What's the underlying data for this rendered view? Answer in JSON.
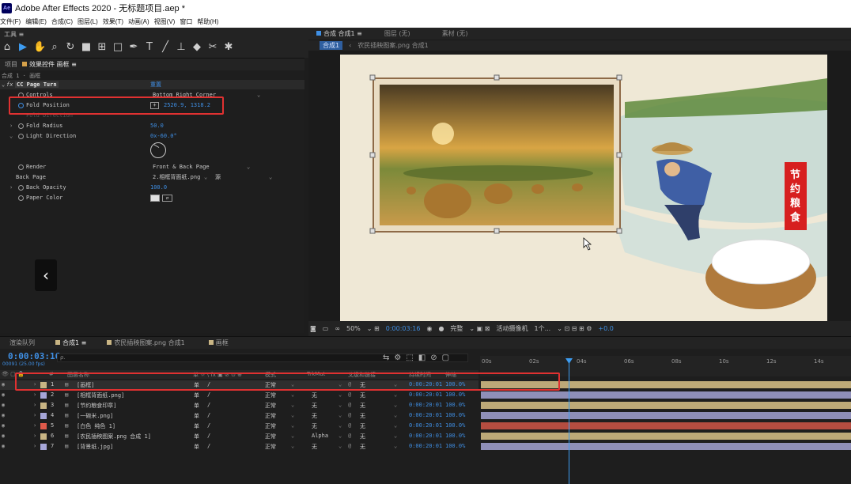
{
  "titlebar": {
    "logo": "Ae",
    "title": "Adobe After Effects 2020 - 无标题项目.aep *"
  },
  "menu": [
    "文件(F)",
    "编辑(E)",
    "合成(C)",
    "图层(L)",
    "效果(T)",
    "动画(A)",
    "视图(V)",
    "窗口",
    "帮助(H)"
  ],
  "toolbar": {
    "label": "工具 ≡",
    "icons": [
      "home-icon",
      "selection-icon",
      "hand-icon",
      "zoom-icon",
      "rotate-icon",
      "camera-icon",
      "pan-behind-icon",
      "rectangle-icon",
      "pen-icon",
      "text-icon",
      "brush-icon",
      "clone-stamp-icon",
      "eraser-icon",
      "roto-brush-icon",
      "puppet-icon"
    ]
  },
  "effects_panel": {
    "tabs": [
      "项目",
      "效果控件 画框 ≡"
    ],
    "breadcrumb": "合成 1 · 画框",
    "effect_name": "CC Page Turn",
    "reset_label": "重置",
    "rows": [
      {
        "name": "Controls",
        "value": "Bottom Right Corner"
      },
      {
        "name": "Fold Position",
        "value": "2520.9, 1318.2"
      },
      {
        "name": "Fold Direction",
        "value": ""
      },
      {
        "name": "Fold Radius",
        "value": "50.0"
      },
      {
        "name": "Light Direction",
        "value": "0x-60.0°"
      },
      {
        "name": "Render",
        "value": "Front & Back Page"
      },
      {
        "name": "Back Page",
        "value": "2.相框背面纸.png",
        "value2": "源"
      },
      {
        "name": "Back Opacity",
        "value": "100.0"
      },
      {
        "name": "Paper Color",
        "value": ""
      }
    ]
  },
  "viewer": {
    "tabs": [
      "合成 合成1 ≡",
      "图层 (无)",
      "素材 (无)"
    ],
    "crumbs": [
      "合成1",
      "农民插秧图案.png 合成1"
    ],
    "stamp_text": "节约粮食",
    "footer": {
      "zoom": "50%",
      "time": "0:00:03:16",
      "quality": "完整",
      "camera": "活动摄像机",
      "views": "1个...",
      "exposure": "+0.0"
    }
  },
  "timeline": {
    "tabs": [
      "渲染队列",
      "合成1 ≡",
      "农民插秧图案.png 合成1",
      "画框"
    ],
    "timecode": "0:00:03:16",
    "fps": "00091 (25.00 fps)",
    "search_placeholder": "ρ.",
    "headers": {
      "num": "#",
      "name": "图层名称",
      "mode": "模式",
      "trkmat": "TrkMat",
      "parent": "父级和链接",
      "in": "持续时间",
      "stretch": "伸缩"
    },
    "ruler": [
      "00s",
      "02s",
      "04s",
      "06s",
      "08s",
      "10s",
      "12s",
      "14s"
    ],
    "layers": [
      {
        "num": "1",
        "name": "[画框]",
        "mode": "正常",
        "trkmat": "",
        "parent": "无",
        "dur": "0:00:20:01",
        "stretch": "100.0%",
        "color": "#c9b584",
        "bar": "#bda978"
      },
      {
        "num": "2",
        "name": "[相框背面纸.png]",
        "mode": "正常",
        "trkmat": "无",
        "parent": "无",
        "dur": "0:00:20:01",
        "stretch": "100.0%",
        "color": "#a6a6d8",
        "bar": "#8f8fb8"
      },
      {
        "num": "3",
        "name": "[节约粮食印章]",
        "mode": "正常",
        "trkmat": "无",
        "parent": "无",
        "dur": "0:00:20:01",
        "stretch": "100.0%",
        "color": "#c9b584",
        "bar": "#bda978"
      },
      {
        "num": "4",
        "name": "[一碗米.png]",
        "mode": "正常",
        "trkmat": "无",
        "parent": "无",
        "dur": "0:00:20:01",
        "stretch": "100.0%",
        "color": "#a6a6d8",
        "bar": "#8f8fb8"
      },
      {
        "num": "5",
        "name": "[白色 纯色 1]",
        "mode": "正常",
        "trkmat": "无",
        "parent": "无",
        "dur": "0:00:20:01",
        "stretch": "100.0%",
        "color": "#e05a4a",
        "bar": "#b54d40"
      },
      {
        "num": "6",
        "name": "[农民插秧图案.png 合成 1]",
        "mode": "正常",
        "trkmat": "Alpha",
        "parent": "无",
        "dur": "0:00:20:01",
        "stretch": "100.0%",
        "color": "#c9b584",
        "bar": "#bda978"
      },
      {
        "num": "7",
        "name": "[背景纸.jpg]",
        "mode": "正常",
        "trkmat": "无",
        "parent": "无",
        "dur": "0:00:20:01",
        "stretch": "100.0%",
        "color": "#a6a6d8",
        "bar": "#8f8fb8"
      }
    ]
  },
  "colors": {
    "accent_blue": "#3f8fe4",
    "highlight_red": "#e03131",
    "label_orange": "#d6a14a"
  }
}
